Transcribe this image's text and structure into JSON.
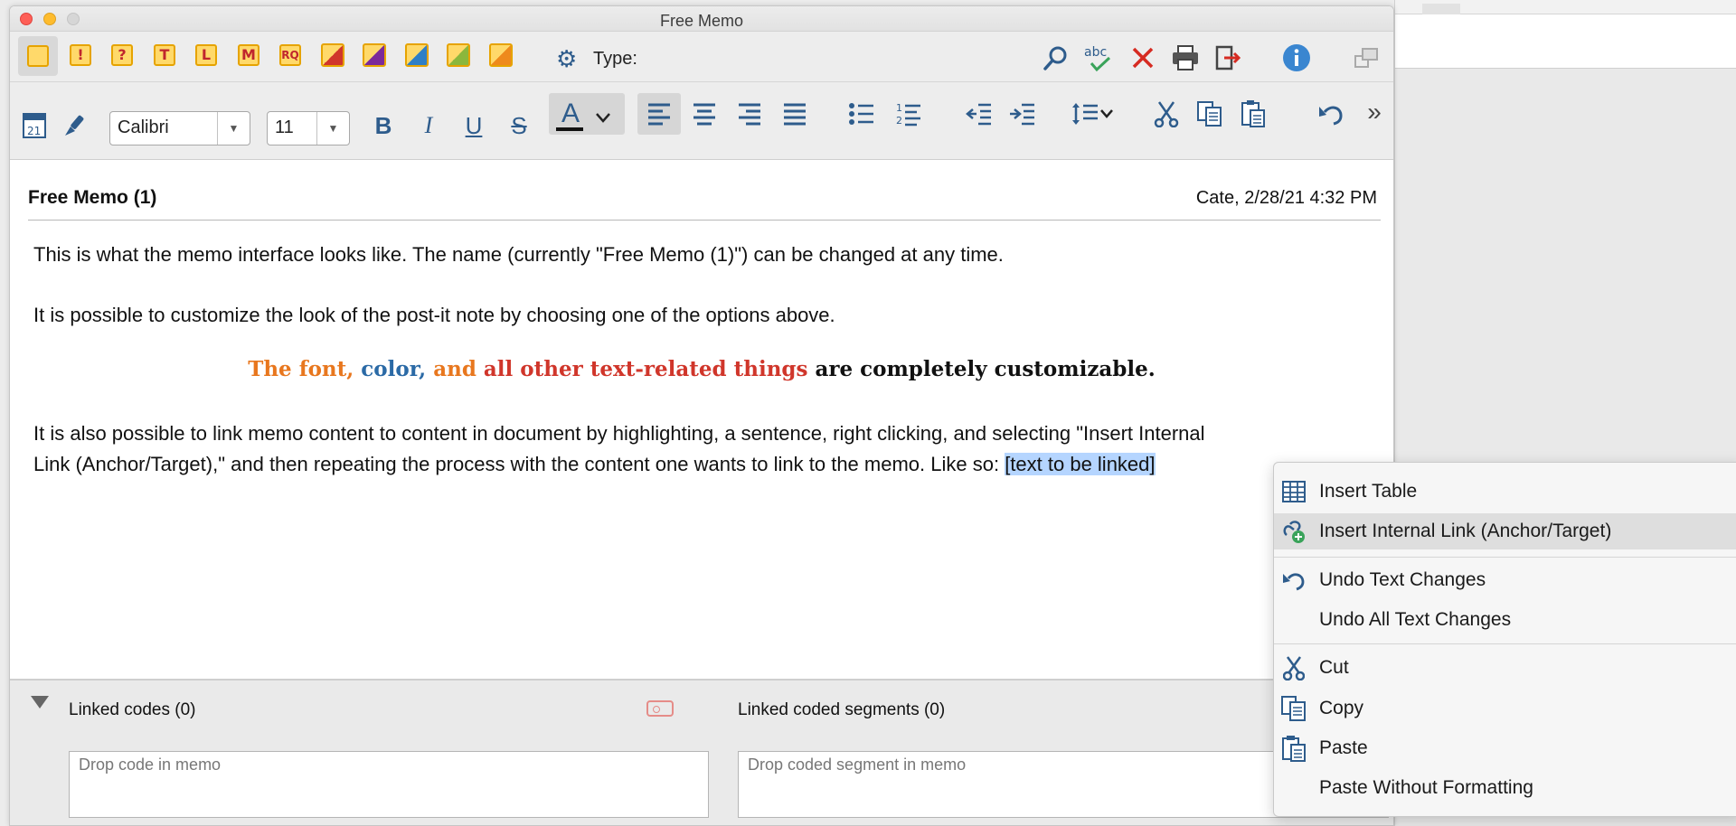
{
  "window": {
    "title": "Free Memo"
  },
  "toolbar1": {
    "memo_types": [
      {
        "name": "memo-plain-icon",
        "glyph": ""
      },
      {
        "name": "memo-exclamation-icon",
        "glyph": "!"
      },
      {
        "name": "memo-question-icon",
        "glyph": "?"
      },
      {
        "name": "memo-t-icon",
        "glyph": "T"
      },
      {
        "name": "memo-l-icon",
        "glyph": "L"
      },
      {
        "name": "memo-m-icon",
        "glyph": "M"
      },
      {
        "name": "memo-rq-icon",
        "glyph": "RQ"
      }
    ],
    "type_label": "Type:"
  },
  "toolbar2": {
    "font_family": "Calibri",
    "font_size": "11",
    "bold": "B",
    "italic": "I",
    "underline": "U",
    "strike": "S",
    "font_color": "A",
    "more": "»"
  },
  "memo": {
    "title": "Free Memo (1)",
    "meta": "Cate, 2/28/21 4:32 PM",
    "para1": "This is what the memo interface looks like. The name (currently \"Free Memo (1)\") can be changed at any time.",
    "para2": "It is possible to customize the look of the post-it note by choosing one of the options above.",
    "center": {
      "part1": "The font, ",
      "part2": "color, ",
      "part3": "and ",
      "part4": "all other text-related things",
      "part5": " are completely customizable."
    },
    "para3_line1": "It is also possible to link memo content to content in document by highlighting, a sentence, right clicking, and selecting \"Insert Internal",
    "para3_line2": "Link (Anchor/Target),\" and then repeating the process with the content one wants to link to the memo. Like so: ",
    "linked_text": "[text to be linked]"
  },
  "bottom": {
    "linked_codes": "Linked codes (0)",
    "linked_segments": "Linked coded segments (0)",
    "drop_code": "Drop code in memo",
    "drop_segment": "Drop coded segment in memo"
  },
  "context_menu": {
    "insert_table": "Insert Table",
    "insert_link": "Insert Internal Link (Anchor/Target)",
    "undo_text": "Undo Text Changes",
    "undo_all": "Undo All Text Changes",
    "cut": "Cut",
    "copy": "Copy",
    "paste": "Paste",
    "paste_plain": "Paste Without Formatting"
  },
  "colors": {
    "orange": "#e8771e",
    "blue": "#2b6aa6",
    "red": "#d0362b",
    "selection": "#b5d5ff",
    "icon_blue": "#2e5c8c"
  }
}
